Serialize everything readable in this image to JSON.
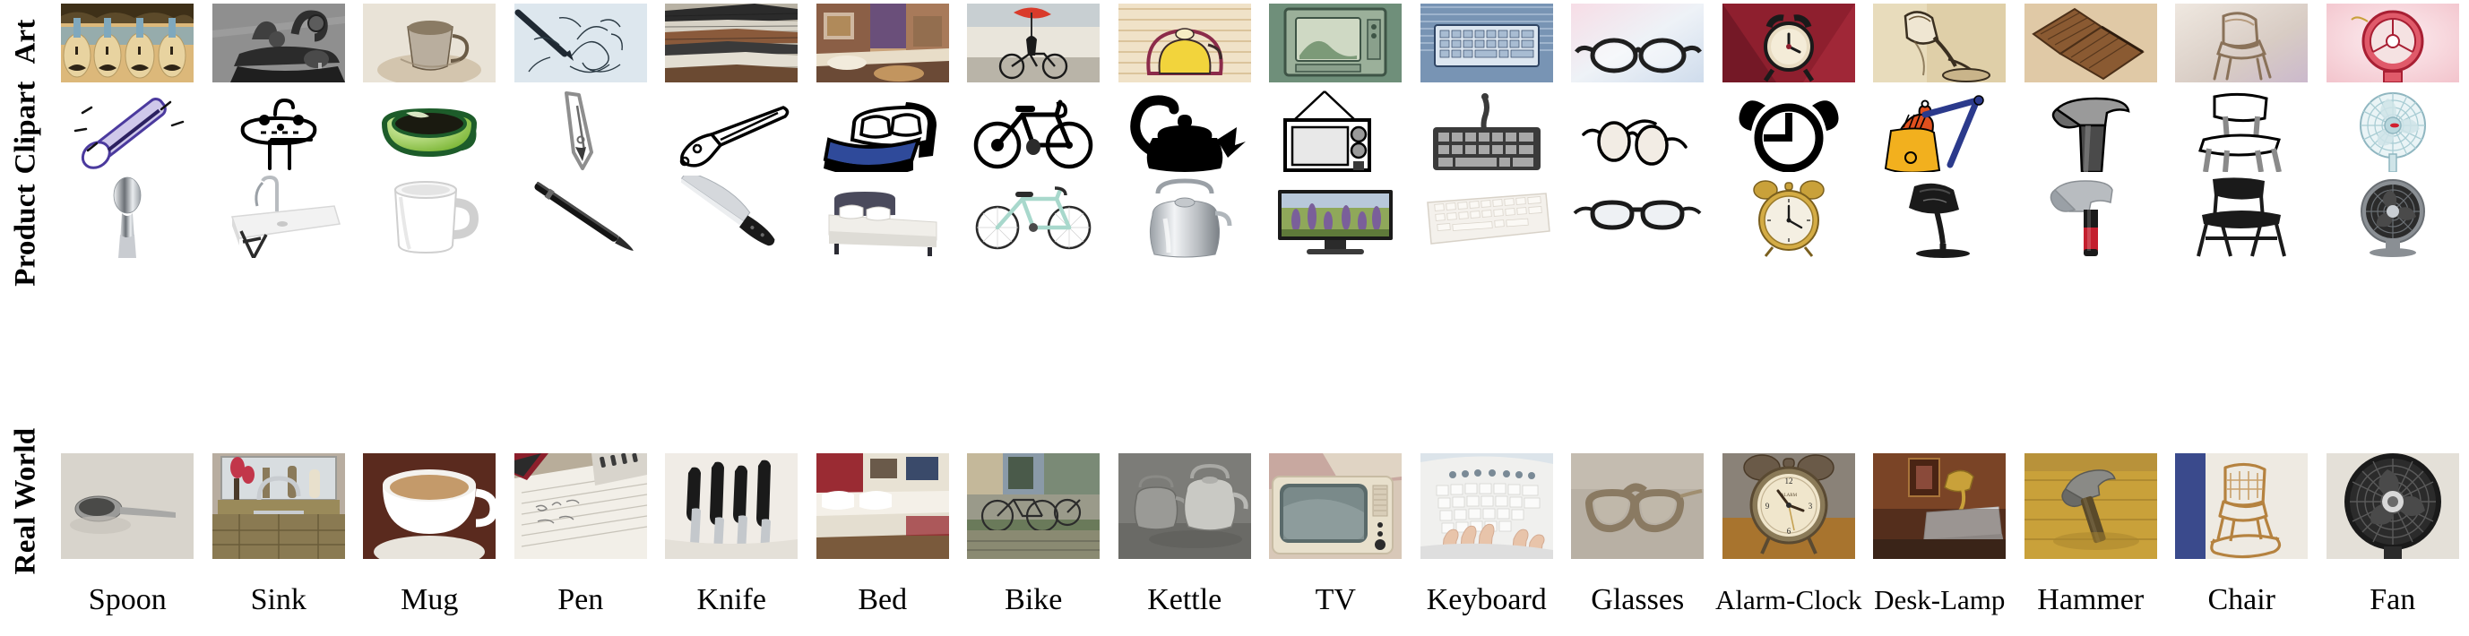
{
  "figure": {
    "kind": "image-grid",
    "rows": 4,
    "cols": 16,
    "background": "#ffffff"
  },
  "row_labels": [
    {
      "id": "art",
      "label": "Art"
    },
    {
      "id": "clipart",
      "label": "Clipart"
    },
    {
      "id": "product",
      "label": "Product"
    },
    {
      "id": "real-world",
      "label": "Real World"
    }
  ],
  "column_labels": [
    "Spoon",
    "Sink",
    "Mug",
    "Pen",
    "Knife",
    "Bed",
    "Bike",
    "Kettle",
    "TV",
    "Keyboard",
    "Glasses",
    "Alarm-Clock",
    "Desk-Lamp",
    "Hammer",
    "Chair",
    "Fan"
  ],
  "cells": {
    "art": [
      {
        "category": "Spoon",
        "description": "Painting of four spoons on sandy beach with blue sky reflections",
        "palette": [
          "#d9b878",
          "#7fa8bd",
          "#4a3a24",
          "#e8d3a0"
        ]
      },
      {
        "category": "Sink",
        "description": "Grainy black-and-white drawing of a chrome basin faucet running",
        "palette": [
          "#8e8e8e",
          "#3a3a3a",
          "#c9c9c9",
          "#5c5c5c"
        ]
      },
      {
        "category": "Mug",
        "description": "Soft pencil sketch of a tipped ceramic mug with brown spill",
        "palette": [
          "#e9e3d7",
          "#9a8a74",
          "#c4b59c",
          "#6b5c47"
        ]
      },
      {
        "category": "Pen",
        "description": "Ink pen drawing a flourished calligraphic swirl on pale paper",
        "palette": [
          "#dde7ee",
          "#1f2933",
          "#9fb3c2",
          "#ffffff"
        ]
      },
      {
        "category": "Knife",
        "description": "Stacked painted kitchen knives with dark handles",
        "palette": [
          "#2b2b2b",
          "#8a5a3b",
          "#d7d2c6",
          "#4f4f4f"
        ]
      },
      {
        "category": "Bed",
        "description": "Impressionist interior painting of a bed in a warm colored room",
        "palette": [
          "#8b5f46",
          "#c9a27a",
          "#6a4f7a",
          "#e0cdb6"
        ]
      },
      {
        "category": "Bike",
        "description": "Illustration of a cyclist riding with a red umbrella",
        "palette": [
          "#d93b2b",
          "#1a1a1a",
          "#e8e4dc",
          "#8a9aa3"
        ]
      },
      {
        "category": "Kettle",
        "description": "Colorful pop-art kettle with yellow body on patterned background",
        "palette": [
          "#f2d43c",
          "#8c2b4a",
          "#f0e2c8",
          "#3b2a2a"
        ]
      },
      {
        "category": "TV",
        "description": "Retro painted television set against green wall",
        "palette": [
          "#6f8f7a",
          "#cfd9c4",
          "#3e5446",
          "#9bb09a"
        ]
      },
      {
        "category": "Keyboard",
        "description": "Blue denim-toned painting of a computer keyboard",
        "palette": [
          "#7894b4",
          "#b8c9de",
          "#2f4564",
          "#e4ecf4"
        ]
      },
      {
        "category": "Glasses",
        "description": "Watercolor eyeglasses over pastel pink and blue wash",
        "palette": [
          "#f2cfd8",
          "#c9d7ea",
          "#2b2b2b",
          "#ffffff"
        ]
      },
      {
        "category": "Alarm-Clock",
        "description": "Crimson painting of an alarm clock with bells",
        "palette": [
          "#8e1f2e",
          "#d8b05a",
          "#1a1a1a",
          "#e8dcc2"
        ]
      },
      {
        "category": "Desk-Lamp",
        "description": "Sepia sketch of an angled desk lamp with shade",
        "palette": [
          "#d8c49a",
          "#6b5636",
          "#efe6d2",
          "#3a2f20"
        ]
      },
      {
        "category": "Hammer",
        "description": "Carved wooden mallet-style hammer on tan background",
        "palette": [
          "#8a5a32",
          "#c49a63",
          "#4b2f18",
          "#e0c9a6"
        ]
      },
      {
        "category": "Chair",
        "description": "Faded pastel painting of an ornate wooden chair",
        "palette": [
          "#e6dcd2",
          "#b59a7d",
          "#cbb9cc",
          "#8a7259"
        ]
      },
      {
        "category": "Fan",
        "description": "Red vintage electric fan on pink gradient background",
        "palette": [
          "#e05a6a",
          "#f6dbe0",
          "#a81f33",
          "#ffffff"
        ]
      }
    ],
    "clipart": [
      {
        "category": "Spoon",
        "description": "Purple and white stylized spoon clipart with motion marks",
        "palette": [
          "#4b3a9e",
          "#cfc8ea",
          "#ffffff",
          "#111111"
        ]
      },
      {
        "category": "Sink",
        "description": "Black outline pedestal sink with curved faucet",
        "palette": [
          "#000000",
          "#ffffff"
        ]
      },
      {
        "category": "Mug",
        "description": "Green gradient coffee cup icon with dark coffee",
        "palette": [
          "#1d5c2a",
          "#9fd14a",
          "#d7ef9a",
          "#1a1a1a"
        ]
      },
      {
        "category": "Pen",
        "description": "Grey line-art fountain pen nib pointing down",
        "palette": [
          "#8e8e8e",
          "#ffffff",
          "#3a3a3a"
        ]
      },
      {
        "category": "Knife",
        "description": "Black outline folding pocket knife drawing",
        "palette": [
          "#000000",
          "#ffffff"
        ]
      },
      {
        "category": "Bed",
        "description": "Double bed with blue blanket and white pillows",
        "palette": [
          "#2f4a9a",
          "#000000",
          "#ffffff"
        ]
      },
      {
        "category": "Bike",
        "description": "Black silhouette outline bicycle side view",
        "palette": [
          "#000000",
          "#ffffff"
        ]
      },
      {
        "category": "Kettle",
        "description": "Bold black whistling kettle with high handle",
        "palette": [
          "#000000",
          "#ffffff"
        ]
      },
      {
        "category": "TV",
        "description": "Old television with rabbit-ear antenna and knobs",
        "palette": [
          "#000000",
          "#e8e8e8",
          "#9a9a9a"
        ]
      },
      {
        "category": "Keyboard",
        "description": "Grey computer keyboard with visible keys",
        "palette": [
          "#3a3a3a",
          "#a8a8a8",
          "#000000"
        ]
      },
      {
        "category": "Glasses",
        "description": "Round wire-frame spectacles line drawing",
        "palette": [
          "#000000",
          "#f2ece4"
        ]
      },
      {
        "category": "Alarm-Clock",
        "description": "Solid black alarm clock with two bells and clock hands",
        "palette": [
          "#000000",
          "#ffffff"
        ]
      },
      {
        "category": "Desk-Lamp",
        "description": "Cartoon yellow and orange lamp with blue swing arm",
        "palette": [
          "#f2b01e",
          "#e0501e",
          "#2b3a8c",
          "#ffffff"
        ]
      },
      {
        "category": "Hammer",
        "description": "Black and white claw hammer clipart",
        "palette": [
          "#9a9a9a",
          "#4a4a4a",
          "#000000",
          "#ffffff"
        ]
      },
      {
        "category": "Chair",
        "description": "Outline sketch of a simple wooden chair",
        "palette": [
          "#000000",
          "#9a9a9a",
          "#ffffff"
        ]
      },
      {
        "category": "Fan",
        "description": "Pale blue pedestal fan with red center cap",
        "palette": [
          "#cfe4e8",
          "#8fb6c0",
          "#d1202f",
          "#ffffff"
        ]
      }
    ],
    "product": [
      {
        "category": "Spoon",
        "description": "Polished silver teaspoon product photo on white",
        "palette": [
          "#c9ccd1",
          "#6b7076",
          "#ffffff"
        ]
      },
      {
        "category": "Sink",
        "description": "White rectangular basin with chrome gooseneck tap",
        "palette": [
          "#f2f2f2",
          "#cfcfcf",
          "#2b2b2b"
        ]
      },
      {
        "category": "Mug",
        "description": "Plain white ceramic mug with handle",
        "palette": [
          "#ffffff",
          "#d8d8d8",
          "#a8a8a8"
        ]
      },
      {
        "category": "Pen",
        "description": "Slim black ballpoint pen at an angle",
        "palette": [
          "#111111",
          "#555555",
          "#ffffff"
        ]
      },
      {
        "category": "Knife",
        "description": "Chef knife with black handle and steel blade",
        "palette": [
          "#d5d8dc",
          "#1a1a1a",
          "#8a8f95"
        ]
      },
      {
        "category": "Bed",
        "description": "Upholstered platform bed with white bedding",
        "palette": [
          "#4a4a5c",
          "#f0eee9",
          "#2b2b33"
        ]
      },
      {
        "category": "Bike",
        "description": "Mint green city bicycle product shot",
        "palette": [
          "#a8d8cc",
          "#2b2b2b",
          "#e8e8e8"
        ]
      },
      {
        "category": "Kettle",
        "description": "Brushed stainless steel whistling kettle",
        "palette": [
          "#c4c8cc",
          "#7a8086",
          "#ffffff"
        ]
      },
      {
        "category": "TV",
        "description": "Flat-screen television showing purple flower field",
        "palette": [
          "#1a1a1a",
          "#7a5f9a",
          "#7fa05a",
          "#c9b6d8"
        ]
      },
      {
        "category": "Keyboard",
        "description": "White slim keyboard angled product photo",
        "palette": [
          "#f4f1ec",
          "#d8d2c8",
          "#9a948a"
        ]
      },
      {
        "category": "Glasses",
        "description": "Black-rimmed eyeglasses with clear lenses",
        "palette": [
          "#1a1a1a",
          "#e8e8e8",
          "#ffffff"
        ]
      },
      {
        "category": "Alarm-Clock",
        "description": "Brass twin-bell alarm clock with white face",
        "palette": [
          "#c9a13a",
          "#f4efe2",
          "#7a5f1e",
          "#1a1a1a"
        ]
      },
      {
        "category": "Desk-Lamp",
        "description": "Black articulated desk lamp with round base",
        "palette": [
          "#1a1a1a",
          "#4a4a4a",
          "#ffffff"
        ]
      },
      {
        "category": "Hammer",
        "description": "Claw hammer with red and black rubber grip",
        "palette": [
          "#b8bcc0",
          "#c4202f",
          "#1a1a1a"
        ]
      },
      {
        "category": "Chair",
        "description": "Black folding chair product photo",
        "palette": [
          "#1a1a1a",
          "#4a4a4a",
          "#ffffff"
        ]
      },
      {
        "category": "Fan",
        "description": "Grey desk fan with dark circular grille",
        "palette": [
          "#8a8f94",
          "#2b2b2b",
          "#c9ced3"
        ]
      }
    ],
    "real-world": [
      {
        "category": "Spoon",
        "description": "Metal spoon lying on a pale kitchen surface",
        "palette": [
          "#d8d4cc",
          "#8a8a8a",
          "#4a4a4a"
        ]
      },
      {
        "category": "Sink",
        "description": "Kitchen sink with chrome mixer tap and window behind",
        "palette": [
          "#b8ada0",
          "#d8dde0",
          "#7a6b4f",
          "#c2364a"
        ]
      },
      {
        "category": "Mug",
        "description": "White mug of milky tea on a dark wooden table",
        "palette": [
          "#5a2a1e",
          "#ffffff",
          "#c49a6a"
        ]
      },
      {
        "category": "Pen",
        "description": "Spiral notebook with handwriting and a pen",
        "palette": [
          "#e8e4dc",
          "#b8ad9a",
          "#3a3a3a",
          "#8c1f2b"
        ]
      },
      {
        "category": "Knife",
        "description": "Set of kitchen knives on a white cloth",
        "palette": [
          "#f0ece6",
          "#1a1a1a",
          "#a8a8a8"
        ]
      },
      {
        "category": "Bed",
        "description": "Hotel bed with white linens and red accent headboard",
        "palette": [
          "#7a5a3c",
          "#f0ece6",
          "#9a2b33",
          "#3a4a6a"
        ]
      },
      {
        "category": "Bike",
        "description": "Bicycles parked on a street near a building",
        "palette": [
          "#6a7a5a",
          "#c4b89a",
          "#2b2b2b",
          "#8a9aa8"
        ]
      },
      {
        "category": "Kettle",
        "description": "Aluminium kettles on a stone surface outdoors",
        "palette": [
          "#9a9a96",
          "#6a6a66",
          "#c9c9c4"
        ]
      },
      {
        "category": "TV",
        "description": "Vintage cream television set in a room",
        "palette": [
          "#e8e0cc",
          "#5a6a6a",
          "#2b2b2b"
        ]
      },
      {
        "category": "Keyboard",
        "description": "Hands typing on a white desktop keyboard",
        "palette": [
          "#f0f0ee",
          "#e8c4aa",
          "#b8b8b4"
        ]
      },
      {
        "category": "Glasses",
        "description": "Pair of eyeglasses resting on a grey surface",
        "palette": [
          "#b8b0a4",
          "#8a7a62",
          "#d8d0c4"
        ]
      },
      {
        "category": "Alarm-Clock",
        "description": "Vintage twin-bell alarm clock on a wooden desk",
        "palette": [
          "#a8742e",
          "#f0e6cc",
          "#3a2a1a"
        ]
      },
      {
        "category": "Desk-Lamp",
        "description": "Brass desk lamp beside a laptop in a wooden alcove",
        "palette": [
          "#6a3a22",
          "#c9a13a",
          "#d8d8d8",
          "#2b1a10"
        ]
      },
      {
        "category": "Hammer",
        "description": "Claw hammer lying on a yellow wooden workbench",
        "palette": [
          "#c9a13a",
          "#8a8a86",
          "#5a4a2a"
        ]
      },
      {
        "category": "Chair",
        "description": "Miniature wooden rocking chair on a pale background",
        "palette": [
          "#3a4a8c",
          "#c9a06a",
          "#e8e4dc"
        ]
      },
      {
        "category": "Fan",
        "description": "Black electric fan with round grille close-up",
        "palette": [
          "#1a1a1a",
          "#4a4a4a",
          "#d8d8d8"
        ]
      }
    ]
  }
}
